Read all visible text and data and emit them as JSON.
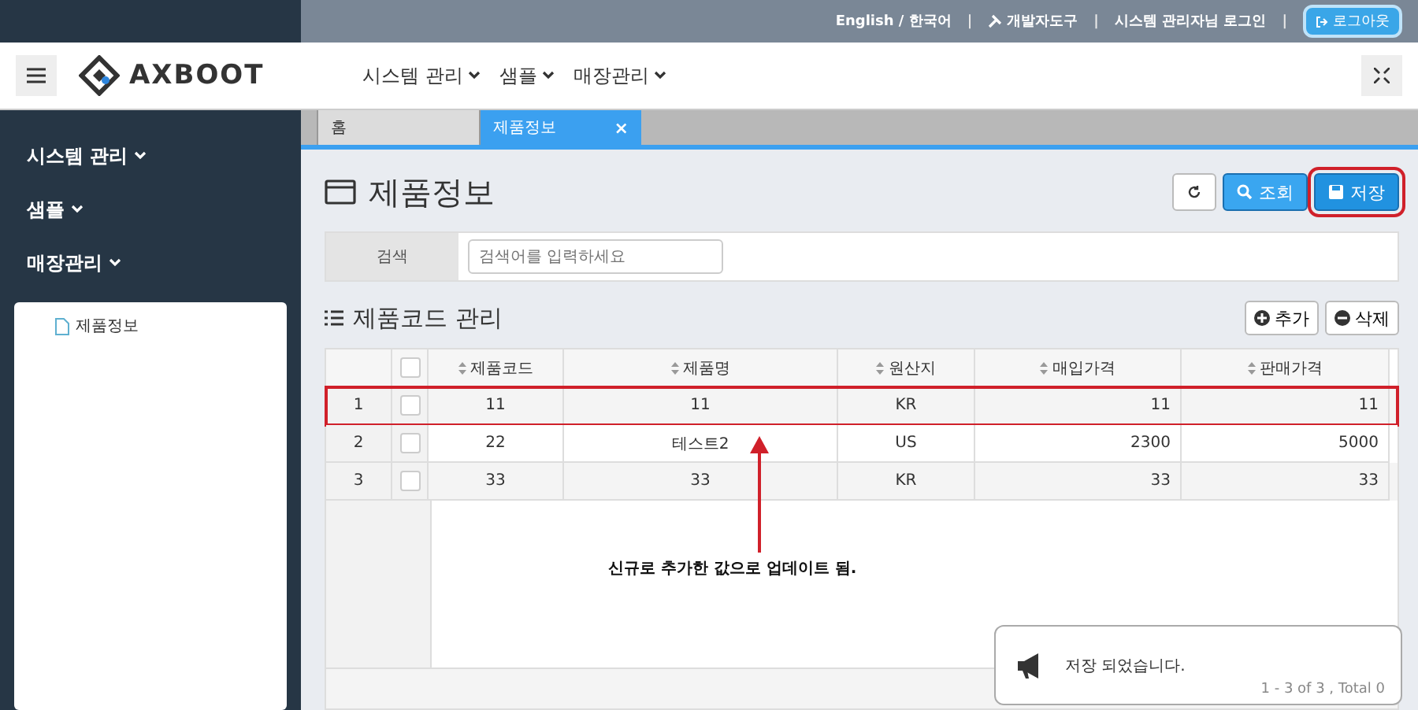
{
  "topbar": {
    "language": "English / 한국어",
    "devtools": "개발자도구",
    "user": "시스템 관리자님 로그인",
    "logout": "로그아웃",
    "separators": [
      "|",
      "|",
      "|"
    ]
  },
  "header": {
    "logo": "AXBOOT",
    "menus": [
      "시스템 관리",
      "샘플",
      "매장관리"
    ]
  },
  "sidebar": {
    "items": [
      {
        "label": "시스템 관리"
      },
      {
        "label": "샘플"
      },
      {
        "label": "매장관리"
      }
    ],
    "submenu": [
      {
        "label": "제품정보"
      }
    ]
  },
  "tabs": [
    {
      "label": "홈",
      "selected": false
    },
    {
      "label": "제품정보",
      "selected": true,
      "close": "×"
    }
  ],
  "page": {
    "title": "제품정보",
    "buttons": [
      {
        "kind": "refresh",
        "highlighted": false
      },
      {
        "kind": "search",
        "label": "조회",
        "highlighted": false
      },
      {
        "kind": "save",
        "label": "저장",
        "highlighted": true
      }
    ]
  },
  "search": {
    "label": "검색",
    "placeholder": "검색어를 입력하세요"
  },
  "section": {
    "title": "제품코드 관리",
    "buttons": [
      {
        "kind": "add",
        "label": "추가"
      },
      {
        "kind": "delete",
        "label": "삭제"
      }
    ]
  },
  "table": {
    "select_all_checked": false,
    "columns": [
      {
        "label": "제품코드",
        "kind": "text"
      },
      {
        "label": "제품명",
        "kind": "text"
      },
      {
        "label": "원산지",
        "kind": "text"
      },
      {
        "label": "매입가격",
        "kind": "number"
      },
      {
        "label": "판매가격",
        "kind": "number"
      }
    ],
    "rows": [
      {
        "num": "1",
        "checked": false,
        "highlighted": true,
        "cells": [
          "11",
          "11",
          "KR",
          "11",
          "11"
        ]
      },
      {
        "num": "2",
        "checked": false,
        "highlighted": false,
        "cells": [
          "22",
          "테스트2",
          "US",
          "2300",
          "5000"
        ]
      },
      {
        "num": "3",
        "checked": false,
        "highlighted": false,
        "cells": [
          "33",
          "33",
          "KR",
          "33",
          "33"
        ]
      }
    ],
    "footer": "1 - 3 of 3 , Total 0"
  },
  "annotation": {
    "caption": "신규로 추가한 값으로 업데이트 됨."
  },
  "toast": {
    "message": "저장 되었습니다."
  }
}
